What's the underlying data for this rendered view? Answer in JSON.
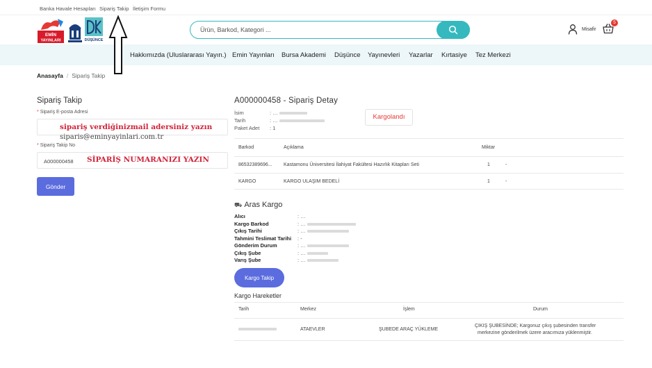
{
  "topbar": {
    "links": [
      "Banka Havale Hesapları",
      "Sipariş Takip",
      "İletişim Formu"
    ]
  },
  "header": {
    "logos": {
      "emin_top": "EMİN",
      "emin_bottom": "YAYINLARI",
      "dk_label": "DÜŞÜNCE"
    },
    "search_placeholder": "Ürün, Barkod, Kategori ...",
    "user_label": "Misafir",
    "basket_count": "5",
    "accent_color": "#35b9be"
  },
  "nav": {
    "items": [
      "Hakkımızda (Uluslararası Yayın.)",
      "Emin Yayınları",
      "Bursa Akademi",
      "Düşünce",
      "Yayınevleri",
      "Yazarlar",
      "Kırtasiye",
      "Tez Merkezi"
    ]
  },
  "breadcrumb": {
    "home": "Anasayfa",
    "separator": "/",
    "current": "Sipariş Takip"
  },
  "form": {
    "title": "Sipariş Takip",
    "email_label": "Sipariş E-posta Adresi",
    "email_note": "sipariş verdiğinizmail adersiniz yazın",
    "email_example": "siparis@eminyayinlari.com.tr",
    "order_label": "Sipariş Takip No",
    "order_value": "A000000458",
    "order_note": "SİPARİŞ NUMARANIZI YAZIN",
    "submit_label": "Gönder",
    "required_mark": "*"
  },
  "detail": {
    "title": "A000000458 - Sipariş Detay",
    "labels": {
      "name": "İsim",
      "date": "Tarih",
      "count": "Paket Adet"
    },
    "values": {
      "name": ": …",
      "date": ": …",
      "count": ": 1"
    },
    "status": "Kargolandı",
    "table": {
      "headers": [
        "Barkod",
        "Açıklama",
        "Miktar"
      ],
      "rows": [
        {
          "barcode": "86532389696...",
          "description": "Kastamonu Üniversitesi İlahiyat Fakültesi Hazırlık Kitapları Seti",
          "qty": "1",
          "extra": "-"
        },
        {
          "barcode": "KARGO",
          "description": "KARGO ULAŞIM BEDELİ",
          "qty": "1",
          "extra": "-"
        }
      ]
    }
  },
  "cargo": {
    "title": "Aras Kargo",
    "fields": [
      {
        "label": "Alıcı",
        "value": ": …"
      },
      {
        "label": "Kargo Barkod",
        "value": ": …"
      },
      {
        "label": "Çıkış Tarihi",
        "value": ": …"
      },
      {
        "label": "Tahmini Teslimat Tarihi",
        "value": ": -"
      },
      {
        "label": "Gönderim Durum",
        "value": ": …"
      },
      {
        "label": "Çıkış Şube",
        "value": ": …"
      },
      {
        "label": "Varış Şube",
        "value": ": …"
      }
    ],
    "track_button": "Kargo Takip",
    "movements_title": "Kargo Hareketler",
    "movements_headers": [
      "Tarih",
      "Merkez",
      "İşlem",
      "Durum"
    ],
    "movement_row": {
      "center": "ATAEVLER",
      "action": "ŞUBEDE ARAÇ YÜKLEME",
      "status_line1": "ÇIKIŞ ŞUBESİNDE; Kargonuz çıkış şubesinden transfer",
      "status_line2": "merkezine gönderilmek üzere aracımıza yüklenmiştir."
    },
    "button_color": "#5b6cde"
  }
}
